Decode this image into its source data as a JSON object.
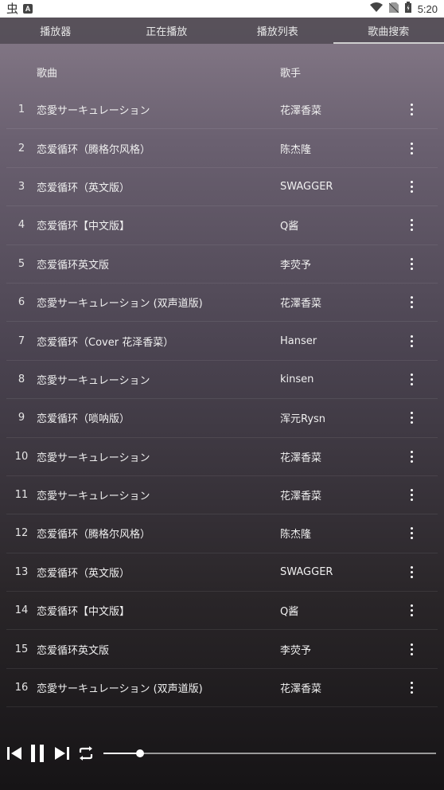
{
  "status": {
    "app_glyph": "虫",
    "badge": "A",
    "time": "5:20"
  },
  "tabs": [
    {
      "label": "播放器",
      "active": false
    },
    {
      "label": "正在播放",
      "active": false
    },
    {
      "label": "播放列表",
      "active": false
    },
    {
      "label": "歌曲搜索",
      "active": true
    }
  ],
  "table": {
    "header": {
      "song": "歌曲",
      "artist": "歌手"
    },
    "rows": [
      {
        "num": "1",
        "song": "恋愛サーキュレーション",
        "artist": "花澤香菜"
      },
      {
        "num": "2",
        "song": "恋爱循环（腾格尔风格）",
        "artist": "陈杰隆"
      },
      {
        "num": "3",
        "song": "恋爱循环（英文版）",
        "artist": "SWAGGER"
      },
      {
        "num": "4",
        "song": "恋爱循环【中文版】",
        "artist": "Q酱"
      },
      {
        "num": "5",
        "song": "恋爱循环英文版",
        "artist": "李荧予"
      },
      {
        "num": "6",
        "song": "恋愛サーキュレーション (双声道版)",
        "artist": "花澤香菜"
      },
      {
        "num": "7",
        "song": "恋爱循环（Cover 花泽香菜）",
        "artist": "Hanser"
      },
      {
        "num": "8",
        "song": "恋愛サーキュレーション",
        "artist": "kinsen"
      },
      {
        "num": "9",
        "song": "恋爱循环（唢呐版）",
        "artist": "浑元Rysn"
      },
      {
        "num": "10",
        "song": "恋愛サーキュレーション",
        "artist": "花澤香菜"
      },
      {
        "num": "11",
        "song": "恋愛サーキュレーション",
        "artist": "花澤香菜"
      },
      {
        "num": "12",
        "song": "恋爱循环（腾格尔风格）",
        "artist": "陈杰隆"
      },
      {
        "num": "13",
        "song": "恋爱循环（英文版）",
        "artist": "SWAGGER"
      },
      {
        "num": "14",
        "song": "恋爱循环【中文版】",
        "artist": "Q酱"
      },
      {
        "num": "15",
        "song": "恋爱循环英文版",
        "artist": "李荧予"
      },
      {
        "num": "16",
        "song": "恋愛サーキュレーション (双声道版)",
        "artist": "花澤香菜"
      }
    ]
  },
  "player": {
    "progress": 0.11,
    "icons": {
      "prev": "skip-previous-icon",
      "pause": "pause-icon",
      "next": "skip-next-icon",
      "repeat": "repeat-icon"
    }
  },
  "colors": {
    "status_bar_bg": "#ffffff",
    "tab_bg": "#504a52",
    "text": "#f0f0f0"
  }
}
